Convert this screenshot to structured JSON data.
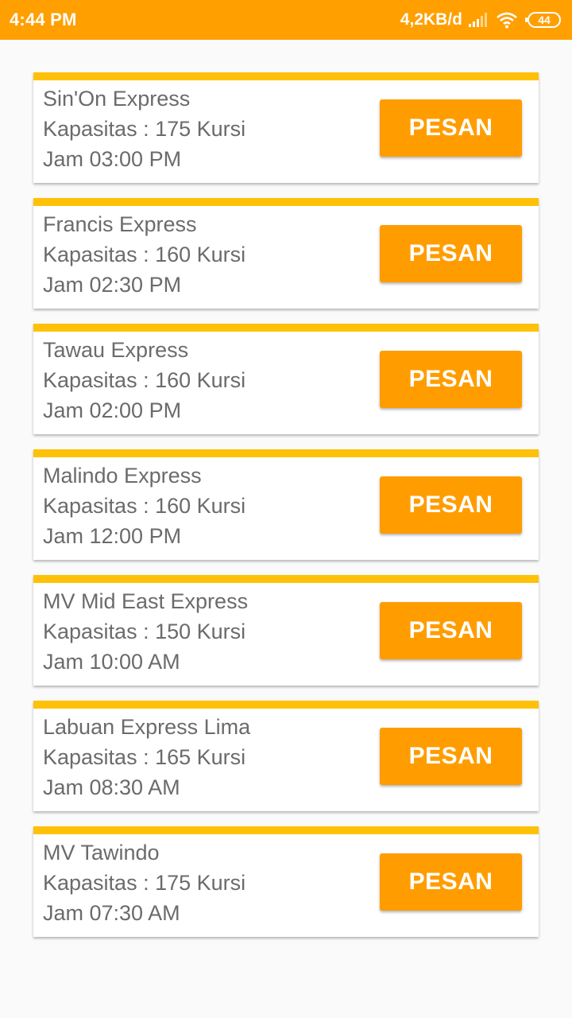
{
  "status_bar": {
    "time": "4:44 PM",
    "network_speed": "4,2KB/d",
    "battery_level": "44",
    "signal_icon": "signal-icon",
    "wifi_icon": "wifi-icon",
    "background_color": "#ff9f00"
  },
  "colors": {
    "card_accent": "#ffc107",
    "button": "#ff9d00",
    "text": "#6b6b6b"
  },
  "ferries": [
    {
      "name": "Sin'On Express",
      "capacity": "Kapasitas : 175 Kursi",
      "time": "Jam 03:00 PM",
      "button_label": "PESAN"
    },
    {
      "name": "Francis Express",
      "capacity": "Kapasitas : 160 Kursi",
      "time": "Jam 02:30 PM",
      "button_label": "PESAN"
    },
    {
      "name": "Tawau Express",
      "capacity": "Kapasitas : 160 Kursi",
      "time": "Jam 02:00 PM",
      "button_label": "PESAN"
    },
    {
      "name": "Malindo Express",
      "capacity": "Kapasitas : 160 Kursi",
      "time": "Jam 12:00 PM",
      "button_label": "PESAN"
    },
    {
      "name": "MV Mid East Express",
      "capacity": "Kapasitas : 150 Kursi",
      "time": "Jam 10:00 AM",
      "button_label": "PESAN"
    },
    {
      "name": "Labuan Express Lima",
      "capacity": "Kapasitas : 165 Kursi",
      "time": "Jam 08:30 AM",
      "button_label": "PESAN"
    },
    {
      "name": "MV Tawindo",
      "capacity": "Kapasitas : 175 Kursi",
      "time": "Jam 07:30 AM",
      "button_label": "PESAN"
    }
  ]
}
